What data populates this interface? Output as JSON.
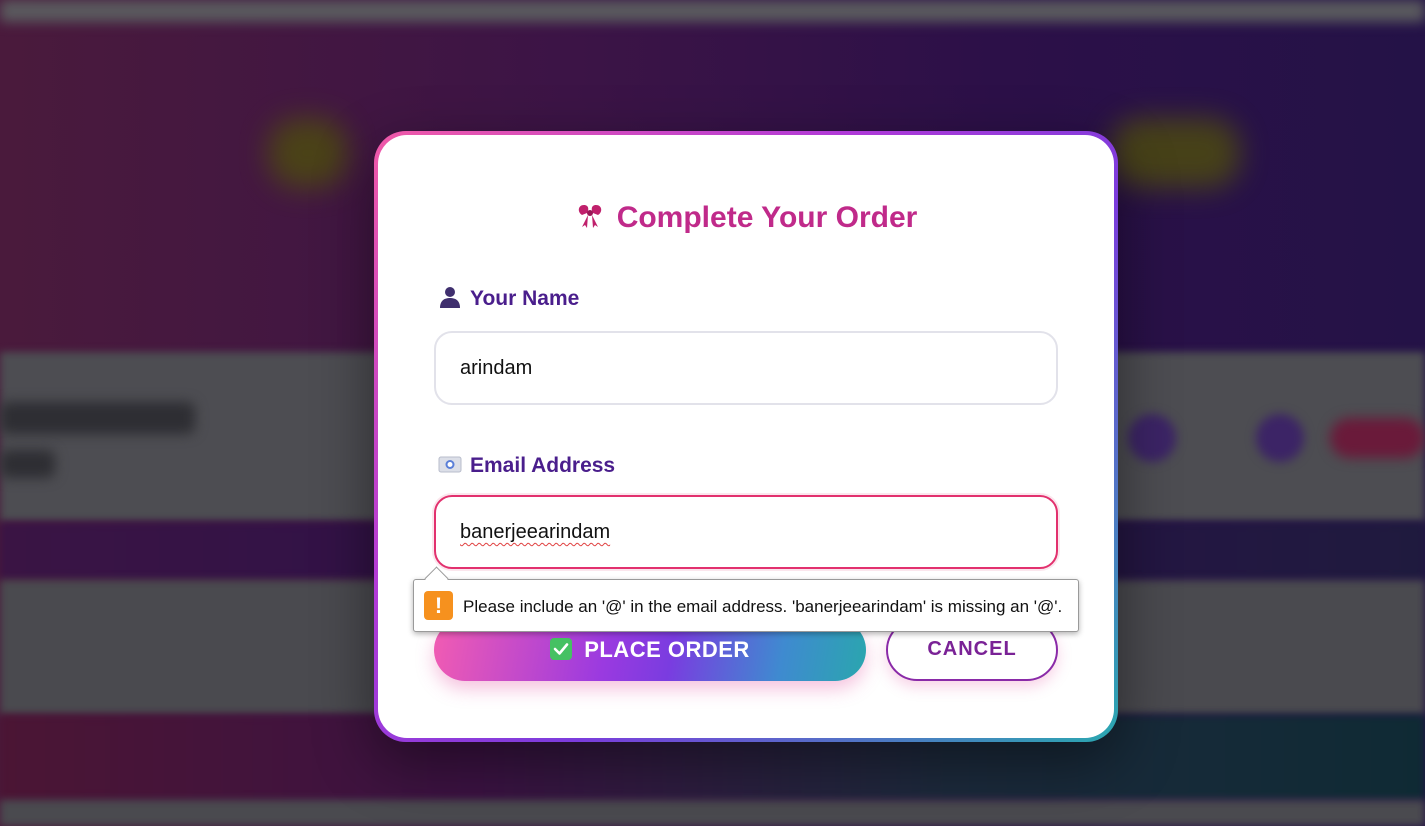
{
  "modal": {
    "title": "Complete Your Order",
    "title_icon": "ribbon-icon",
    "name_label": "Your Name",
    "name_icon": "person-icon",
    "name_value": "arindam",
    "email_label": "Email Address",
    "email_icon": "id-card-icon",
    "email_value": "banerjeearindam",
    "place_order_label": "PLACE ORDER",
    "place_order_icon": "checkmark-icon",
    "cancel_label": "CANCEL"
  },
  "validation": {
    "message": "Please include an '@' in the email address. 'banerjeearindam' is missing an '@'.",
    "icon": "warning-icon",
    "icon_color": "#f6911e"
  },
  "colors": {
    "title": "#c02a8a",
    "label": "#4a1e8c",
    "invalid_border": "#e2316e"
  }
}
